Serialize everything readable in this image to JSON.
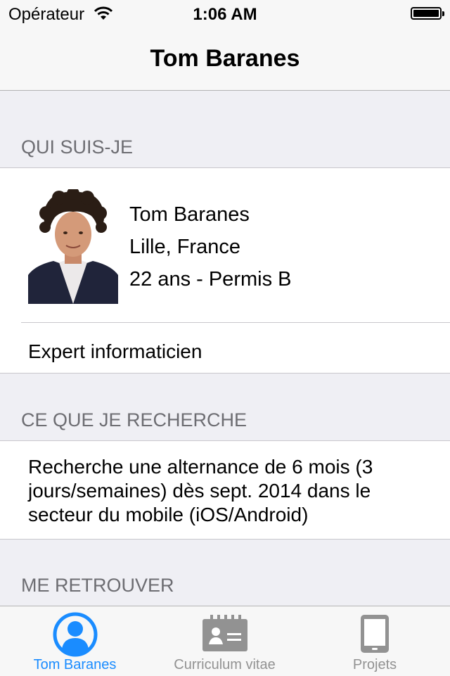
{
  "status_bar": {
    "carrier": "Opérateur",
    "time": "1:06 AM"
  },
  "nav": {
    "title": "Tom Baranes"
  },
  "sections": {
    "about": {
      "header": "QUI SUIS-JE",
      "name": "Tom Baranes",
      "location": "Lille, France",
      "age_license": "22 ans - Permis B",
      "tagline": "Expert informaticien"
    },
    "looking_for": {
      "header": "CE QUE JE RECHERCHE",
      "text": "Recherche une alternance de 6 mois (3 jours/semaines) dès sept. 2014 dans le secteur du mobile (iOS/Android)"
    },
    "find_me": {
      "header": "ME RETROUVER"
    }
  },
  "tabbar": {
    "accent_color": "#1a8cff",
    "inactive_color": "#929292",
    "tabs": [
      {
        "label": "Tom Baranes",
        "icon": "profile-icon",
        "selected": true
      },
      {
        "label": "Curriculum vitae",
        "icon": "contact-card-icon",
        "selected": false
      },
      {
        "label": "Projets",
        "icon": "tablet-icon",
        "selected": false
      }
    ]
  }
}
